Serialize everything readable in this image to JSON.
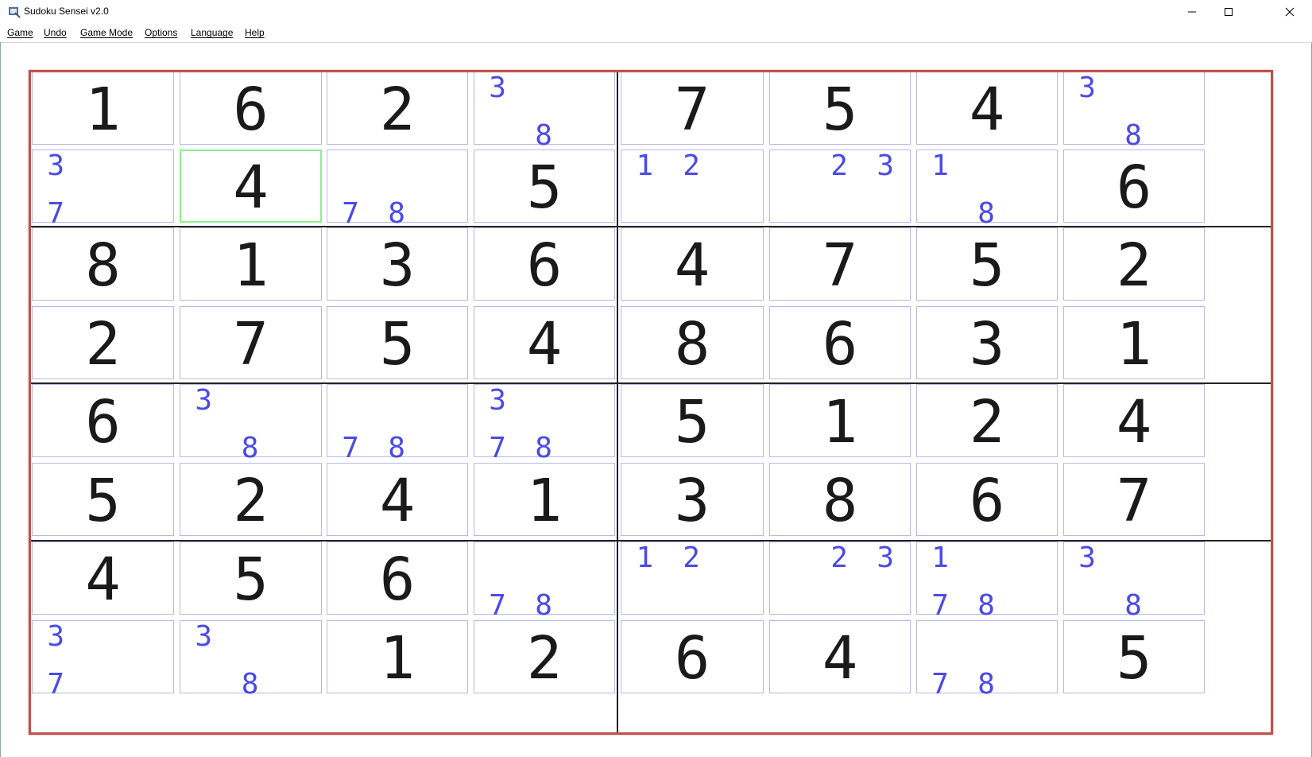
{
  "window": {
    "title": "Sudoku Sensei v2.0",
    "controls": [
      "minimize",
      "maximize",
      "close"
    ]
  },
  "menu": [
    {
      "label": "Game"
    },
    {
      "label": "Undo"
    },
    {
      "label": "Game Mode"
    },
    {
      "label": "Options"
    },
    {
      "label": "Language"
    },
    {
      "label": "Help"
    }
  ],
  "colors": {
    "board_border": "#c0504d",
    "cell_border": "#b8b8e6",
    "pencil_marks": "#4a4ae8",
    "given_digits": "#1a1a1a",
    "selected_cell": "#90ee90"
  },
  "grid": {
    "rows": 8,
    "cols": 8,
    "box_rows": 2,
    "box_cols": 4,
    "selected": {
      "row": 1,
      "col": 1
    },
    "cells": [
      [
        "1",
        "6",
        "2",
        [
          "3",
          "",
          "",
          "",
          "",
          "",
          "",
          "8",
          ""
        ],
        "7",
        "5",
        "4",
        [
          "3",
          "",
          "",
          "",
          "",
          "",
          "",
          "8",
          ""
        ]
      ],
      [
        [
          "3",
          "",
          "",
          "",
          "",
          "",
          "7",
          "",
          ""
        ],
        "4",
        [
          "",
          "",
          "",
          "",
          "",
          "",
          "7",
          "8",
          ""
        ],
        "5",
        [
          "1",
          "2",
          "",
          "",
          "",
          "",
          "",
          "",
          ""
        ],
        [
          "",
          "2",
          "3",
          "",
          "",
          "",
          "",
          "",
          ""
        ],
        [
          "1",
          "",
          "",
          "",
          "",
          "",
          "",
          "8",
          ""
        ],
        "6"
      ],
      [
        "8",
        "1",
        "3",
        "6",
        "4",
        "7",
        "5",
        "2"
      ],
      [
        "2",
        "7",
        "5",
        "4",
        "8",
        "6",
        "3",
        "1"
      ],
      [
        "6",
        [
          "3",
          "",
          "",
          "",
          "",
          "",
          "",
          "8",
          ""
        ],
        [
          "",
          "",
          "",
          "",
          "",
          "",
          "7",
          "8",
          ""
        ],
        [
          "3",
          "",
          "",
          "",
          "",
          "",
          "7",
          "8",
          ""
        ],
        "5",
        "1",
        "2",
        "4"
      ],
      [
        "5",
        "2",
        "4",
        "1",
        "3",
        "8",
        "6",
        "7"
      ],
      [
        "4",
        "5",
        "6",
        [
          "",
          "",
          "",
          "",
          "",
          "",
          "7",
          "8",
          ""
        ],
        [
          "1",
          "2",
          "",
          "",
          "",
          "",
          "",
          "",
          ""
        ],
        [
          "",
          "2",
          "3",
          "",
          "",
          "",
          "",
          "",
          ""
        ],
        [
          "1",
          "",
          "",
          "",
          "",
          "",
          "7",
          "8",
          ""
        ],
        [
          "3",
          "",
          "",
          "",
          "",
          "",
          "",
          "8",
          ""
        ]
      ],
      [
        [
          "3",
          "",
          "",
          "",
          "",
          "",
          "7",
          "",
          ""
        ],
        [
          "3",
          "",
          "",
          "",
          "",
          "",
          "",
          "8",
          ""
        ],
        "1",
        "2",
        "6",
        "4",
        [
          "",
          "",
          "",
          "",
          "",
          "",
          "7",
          "8",
          ""
        ],
        "5"
      ]
    ]
  }
}
